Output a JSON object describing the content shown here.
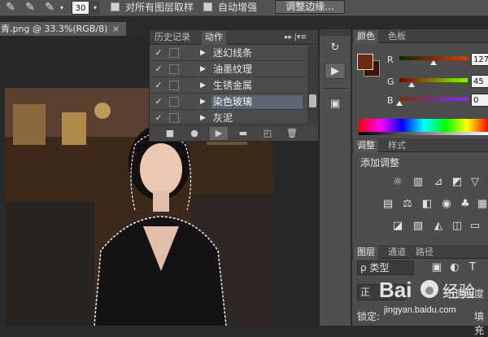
{
  "options_bar": {
    "brush_size": "30",
    "sample_all_layers_label": "对所有图层取样",
    "auto_enhance_label": "自动增强",
    "refine_edge_label": "调整边缘..."
  },
  "document": {
    "tab_title": "青.png @ 33.3%(RGB/8)",
    "close_glyph": "×"
  },
  "actions_panel": {
    "tabs": [
      "历史记录",
      "动作"
    ],
    "active_tab": "动作",
    "menu_glyph": "▸▸ |▾≡",
    "actions": [
      {
        "name": "迷幻线条",
        "checked": true,
        "selected": false
      },
      {
        "name": "油墨纹理",
        "checked": true,
        "selected": false
      },
      {
        "name": "生锈金属",
        "checked": true,
        "selected": false
      },
      {
        "name": "染色玻璃",
        "checked": true,
        "selected": true
      },
      {
        "name": "灰泥",
        "checked": true,
        "selected": false
      }
    ]
  },
  "color_panel": {
    "tabs": [
      "颜色",
      "色板"
    ],
    "active_tab": "颜色",
    "foreground_color": "#6d2b0f",
    "background_color": "#3a1206",
    "channels": [
      {
        "label": "R",
        "value": "127",
        "level": 0.498
      },
      {
        "label": "G",
        "value": "45",
        "level": 0.176
      },
      {
        "label": "B",
        "value": "0",
        "level": 0.0
      }
    ]
  },
  "adjustments_panel": {
    "tabs": [
      "调整",
      "样式"
    ],
    "active_tab": "调整",
    "heading": "添加调整"
  },
  "layers_panel": {
    "tabs": [
      "图层",
      "通道",
      "路径"
    ],
    "active_tab": "图层",
    "filter_label": "ρ 类型",
    "blend_mode": "正",
    "opacity_label": "不透明度",
    "lock_label": "锁定:",
    "fill_label": "填充"
  },
  "watermark": {
    "logo_text": "Bai  经验",
    "url": "jingyan.baidu.com"
  },
  "icons": {
    "brush_tools": [
      "brush-icon",
      "brush-plus-icon",
      "brush-minus-icon"
    ],
    "action_bottom": [
      "stop-icon",
      "record-icon",
      "play-icon",
      "new-set-icon",
      "new-action-icon",
      "trash-icon"
    ],
    "adjustments_row1": [
      "brightness-icon",
      "levels-icon",
      "curves-icon",
      "exposure-icon",
      "vibrance-icon"
    ],
    "adjustments_row2": [
      "hue-icon",
      "balance-icon",
      "bw-icon",
      "photo-filter-icon",
      "channel-mixer-icon",
      "color-lookup-icon"
    ],
    "adjustments_row3": [
      "invert-icon",
      "posterize-icon",
      "threshold-icon",
      "selective-color-icon",
      "gradient-map-icon"
    ]
  }
}
